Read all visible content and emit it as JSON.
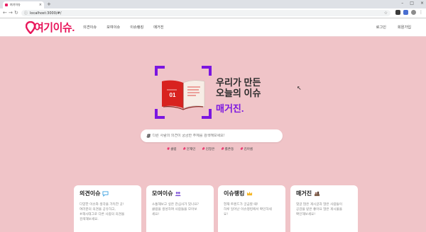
{
  "browser": {
    "tab_title": "여기이슈",
    "tab_close": "×",
    "new_tab": "+",
    "window_controls": [
      "–",
      "□",
      "×"
    ],
    "url": "localhost:3000/#/"
  },
  "header": {
    "logo_text": "여기이슈.",
    "nav": [
      "의견이슈",
      "모여이슈",
      "이슈랭킹",
      "매거진"
    ],
    "auth": {
      "login": "로그인",
      "signup": "회원가입"
    }
  },
  "hero": {
    "book_number": "01",
    "title_line1": "우리가 만든",
    "title_line2": "오늘의 이슈",
    "accent": "매거진."
  },
  "search": {
    "placeholder": "다른 사람의 의견이 궁금한 주제를 검색해보세요!",
    "tags": [
      "클럽",
      "문재인",
      "김정은",
      "롤촌동",
      "김아름"
    ]
  },
  "cards": [
    {
      "title": "의견이슈",
      "icon": "speech-bubble-icon",
      "desc": [
        "다양한 이슈와 생각을 가득한 곳!",
        "여러분의 의견을 공유하고,",
        "#해시태그로 다른 사람의 의견을",
        "검색해보세요."
      ]
    },
    {
      "title": "모여이슈",
      "icon": "people-icon",
      "desc": [
        "소통해보고 싶은 관심사가 있나요?",
        "클럽을 생성하여 사람들을 모아보",
        "세요!"
      ]
    },
    {
      "title": "이슈랭킹",
      "icon": "crown-icon",
      "desc": [
        "현재 트렌드가 궁금할 때!",
        "하루 일어난 이슈랭킹에서 확인하세",
        "요!"
      ]
    },
    {
      "title": "매거진",
      "icon": "book-icon",
      "desc": [
        "댓글 많은 게시글과 많은 사람들이",
        "공감을 받은 좋아요 많은 게시물을",
        "확인해보세요!"
      ]
    }
  ],
  "colors": {
    "brand": "#e8155a",
    "accent": "#7b16e0",
    "background": "#f0c4c8"
  }
}
